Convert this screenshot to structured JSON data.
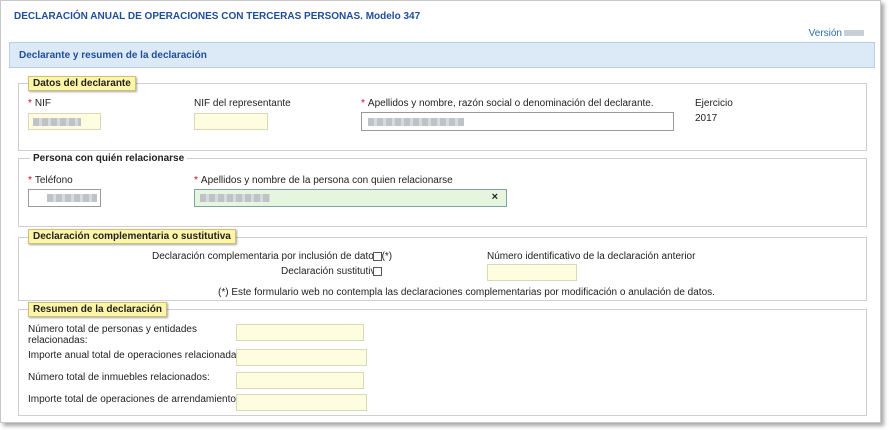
{
  "app": {
    "title": "DECLARACIÓN ANUAL DE OPERACIONES CON TERCERAS PERSONAS. Modelo 347",
    "version_label": "Versión"
  },
  "header": {
    "title": "Declarante y resumen de la declaración"
  },
  "declarante": {
    "legend": "Datos del declarante",
    "nif_label": "NIF",
    "nif_rep_label": "NIF del representante",
    "nombre_label": "Apellidos y nombre, razón social o denominación del declarante.",
    "ejercicio_label": "Ejercicio",
    "ejercicio_value": "2017"
  },
  "contacto": {
    "legend": "Persona con quién relacionarse",
    "telefono_label": "Teléfono",
    "nombre_label": "Apellidos y nombre de la persona con quien relacionarse",
    "clear_symbol": "×"
  },
  "complementaria": {
    "legend": "Declaración complementaria o sustitutiva",
    "comp_label": "Declaración complementaria por inclusión de datos (*)",
    "sust_label": "Declaración sustitutiva",
    "numero_label": "Número identificativo de la declaración anterior",
    "note": "(*) Este formulario web no contempla las declaraciones complementarias por modificación o anulación de datos."
  },
  "resumen": {
    "legend": "Resumen de la declaración",
    "personas_label_1": "Número total de personas y entidades",
    "personas_label_2": "relacionadas:",
    "importe_label": "Importe anual total de operaciones relacionadas:",
    "inmuebles_label": "Número total de inmuebles relacionados:",
    "arrendamiento_label": "Importe total de operaciones de arrendamiento:"
  },
  "required_mark": "*",
  "colors": {
    "accent": "#1f4e9a",
    "legend_bg": "#fdf6a7",
    "input_bg": "#fffde0",
    "header_bg": "#dbeaf6"
  }
}
